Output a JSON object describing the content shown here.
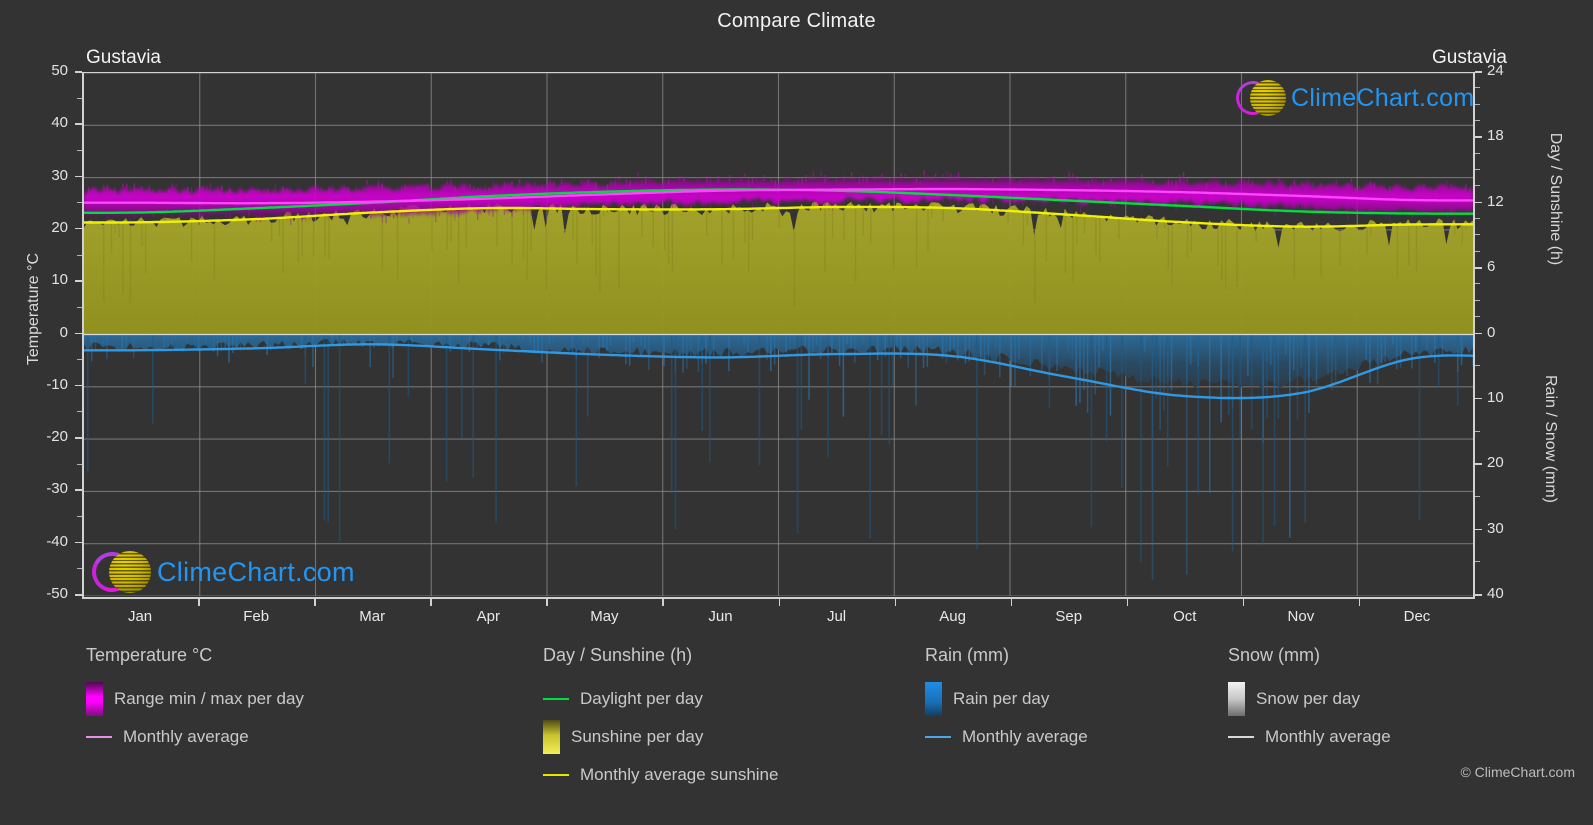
{
  "header": {
    "title": "Compare Climate",
    "location_left": "Gustavia",
    "location_right": "Gustavia"
  },
  "axes": {
    "y_left_title": "Temperature °C",
    "y_right_title_top": "Day / Sunshine (h)",
    "y_right_title_bottom": "Rain / Snow (mm)",
    "y_left_ticks": [
      "50",
      "40",
      "30",
      "20",
      "10",
      "0",
      "-10",
      "-20",
      "-30",
      "-40",
      "-50"
    ],
    "y_right_top_ticks": [
      "24",
      "18",
      "12",
      "6",
      "0"
    ],
    "y_right_bottom_ticks": [
      "0",
      "10",
      "20",
      "30",
      "40"
    ],
    "x_ticks": [
      "Jan",
      "Feb",
      "Mar",
      "Apr",
      "May",
      "Jun",
      "Jul",
      "Aug",
      "Sep",
      "Oct",
      "Nov",
      "Dec"
    ]
  },
  "legend": {
    "groups": [
      {
        "title": "Temperature °C",
        "items": [
          {
            "label": "Range min / max per day",
            "marker": "box",
            "color": "#ff00ff"
          },
          {
            "label": "Monthly average",
            "marker": "line",
            "color": "#e88fe8"
          }
        ]
      },
      {
        "title": "Day / Sunshine (h)",
        "items": [
          {
            "label": "Daylight per day",
            "marker": "line",
            "color": "#00e03c"
          },
          {
            "label": "Sunshine per day",
            "marker": "box",
            "color": "#eded45"
          },
          {
            "label": "Monthly average sunshine",
            "marker": "line",
            "color": "#e6e600"
          }
        ]
      },
      {
        "title": "Rain (mm)",
        "items": [
          {
            "label": "Rain per day",
            "marker": "box",
            "color": "#1288e0"
          },
          {
            "label": "Monthly average",
            "marker": "line",
            "color": "#4aa8e8"
          }
        ]
      },
      {
        "title": "Snow (mm)",
        "items": [
          {
            "label": "Snow per day",
            "marker": "box",
            "color": "#e6e6e6"
          },
          {
            "label": "Monthly average",
            "marker": "line",
            "color": "#d9d9d9"
          }
        ]
      }
    ]
  },
  "branding": {
    "logo_text": "ClimeChart.com",
    "copyright": "© ClimeChart.com"
  },
  "colors": {
    "background": "#333333",
    "grid": "#8f8f8f",
    "axis": "#d2d2d2",
    "text": "#e2e2e2",
    "temp_band": "#d400d4",
    "temp_avg": "#ff5cff",
    "daylight": "#00e03c",
    "sunshine_fill": "#9a9a28",
    "sunshine_avg": "#f0f000",
    "rain_fill": "#1e5f8c",
    "rain_avg": "#2e9ae6"
  },
  "chart_data": {
    "type": "area",
    "title": "Compare Climate",
    "subtitle": "Gustavia",
    "xlabel": "",
    "ylabel": "Temperature °C",
    "categories": [
      "Jan",
      "Feb",
      "Mar",
      "Apr",
      "May",
      "Jun",
      "Jul",
      "Aug",
      "Sep",
      "Oct",
      "Nov",
      "Dec"
    ],
    "axis_left": {
      "label": "Temperature °C",
      "min": -50,
      "max": 50,
      "ticks": [
        50,
        40,
        30,
        20,
        10,
        0,
        -10,
        -20,
        -30,
        -40,
        -50
      ]
    },
    "axis_right_top": {
      "label": "Day / Sunshine (h)",
      "min": 0,
      "max": 24,
      "ticks": [
        24,
        18,
        12,
        6,
        0
      ],
      "maps_to_temp": [
        0,
        50
      ]
    },
    "axis_right_bottom": {
      "label": "Rain / Snow (mm)",
      "min": 0,
      "max": 40,
      "ticks": [
        0,
        10,
        20,
        30,
        40
      ],
      "maps_to_temp": [
        0,
        -50
      ]
    },
    "grid": true,
    "legend_position": "bottom",
    "series": [
      {
        "name": "Monthly average temperature",
        "unit": "°C",
        "color": "#ff5cff",
        "values": [
          25.2,
          25.1,
          25.4,
          26.0,
          26.8,
          27.5,
          27.7,
          27.8,
          27.6,
          27.2,
          26.5,
          25.7
        ]
      },
      {
        "name": "Range min per day",
        "unit": "°C",
        "color": "#d400d4",
        "values": [
          23.0,
          22.9,
          23.2,
          23.9,
          24.9,
          25.6,
          25.8,
          25.9,
          25.7,
          25.3,
          24.5,
          23.6
        ]
      },
      {
        "name": "Range max per day",
        "unit": "°C",
        "color": "#d400d4",
        "values": [
          27.3,
          27.3,
          27.6,
          28.2,
          28.8,
          29.3,
          29.6,
          29.7,
          29.5,
          29.1,
          28.5,
          27.8
        ]
      },
      {
        "name": "Daylight per day",
        "unit": "h",
        "color": "#00e03c",
        "values": [
          11.2,
          11.6,
          12.1,
          12.7,
          13.1,
          13.3,
          13.2,
          12.8,
          12.3,
          11.8,
          11.3,
          11.1
        ]
      },
      {
        "name": "Monthly average sunshine",
        "unit": "h",
        "color": "#f0f000",
        "values": [
          10.3,
          10.6,
          11.2,
          11.6,
          11.5,
          11.5,
          11.7,
          11.6,
          11.0,
          10.3,
          9.9,
          10.1
        ]
      },
      {
        "name": "Rain monthly average",
        "unit": "mm",
        "color": "#2e9ae6",
        "values": [
          2.4,
          2.1,
          1.5,
          2.3,
          3.1,
          3.5,
          3.0,
          3.3,
          6.5,
          9.4,
          9.0,
          3.6
        ]
      },
      {
        "name": "Snow monthly average",
        "unit": "mm",
        "color": "#d9d9d9",
        "values": [
          0,
          0,
          0,
          0,
          0,
          0,
          0,
          0,
          0,
          0,
          0,
          0
        ]
      }
    ]
  }
}
